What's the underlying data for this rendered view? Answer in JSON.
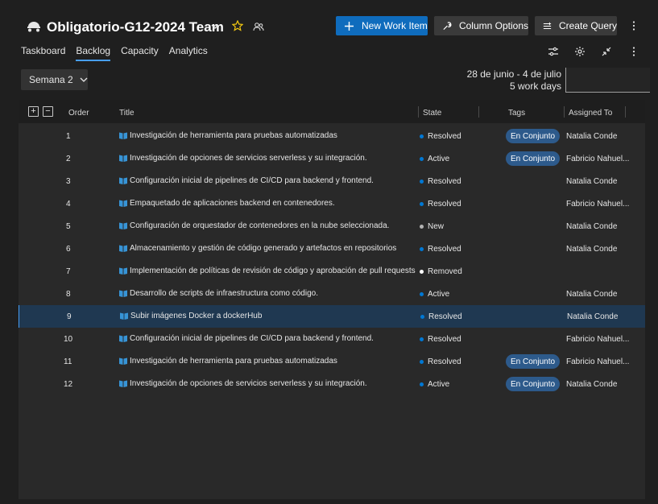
{
  "header": {
    "team_title": "Obligatorio-G12-2024 Team",
    "new_work_item": "New Work Item",
    "column_options": "Column Options",
    "create_query": "Create Query"
  },
  "tabs": [
    "Taskboard",
    "Backlog",
    "Capacity",
    "Analytics"
  ],
  "active_tab": "Backlog",
  "sprint": {
    "selector": "Semana 2",
    "date_range": "28 de junio - 4 de julio",
    "work_days": "5 work days"
  },
  "columns": {
    "order": "Order",
    "title": "Title",
    "state": "State",
    "tags": "Tags",
    "assigned": "Assigned To"
  },
  "expand_all": "+",
  "collapse_all": "−",
  "state_colors": {
    "Resolved": "#0078d4",
    "Active": "#0078d4",
    "New": "#b2b2b2",
    "Removed": "#ffffff"
  },
  "rows": [
    {
      "order": "1",
      "title": "Investigación de herramienta para pruebas automatizadas",
      "state": "Resolved",
      "tag": "En Conjunto",
      "assigned": "Natalia Conde"
    },
    {
      "order": "2",
      "title": "Investigación de opciones de servicios serverless y su integración.",
      "state": "Active",
      "tag": "En Conjunto",
      "assigned": "Fabricio Nahuel..."
    },
    {
      "order": "3",
      "title": "Configuración inicial de pipelines de CI/CD para backend y frontend.",
      "state": "Resolved",
      "tag": "",
      "assigned": "Natalia Conde"
    },
    {
      "order": "4",
      "title": "Empaquetado de aplicaciones backend en contenedores.",
      "state": "Resolved",
      "tag": "",
      "assigned": "Fabricio Nahuel..."
    },
    {
      "order": "5",
      "title": "Configuración de orquestador de contenedores en la nube seleccionada.",
      "state": "New",
      "tag": "",
      "assigned": "Natalia Conde"
    },
    {
      "order": "6",
      "title": "Almacenamiento y gestión de código generado y artefactos en repositorios",
      "state": "Resolved",
      "tag": "",
      "assigned": "Natalia Conde"
    },
    {
      "order": "7",
      "title": "Implementación de políticas de revisión de código y aprobación de pull requests",
      "state": "Removed",
      "tag": "",
      "assigned": ""
    },
    {
      "order": "8",
      "title": "Desarrollo de scripts de infraestructura como código.",
      "state": "Active",
      "tag": "",
      "assigned": "Natalia Conde"
    },
    {
      "order": "9",
      "title": "Subir imágenes Docker a dockerHub",
      "state": "Resolved",
      "tag": "",
      "assigned": "Natalia Conde",
      "selected": true
    },
    {
      "order": "10",
      "title": "Configuración inicial de pipelines de CI/CD para backend y frontend.",
      "state": "Resolved",
      "tag": "",
      "assigned": "Fabricio Nahuel..."
    },
    {
      "order": "11",
      "title": "Investigación de herramienta para pruebas automatizadas",
      "state": "Resolved",
      "tag": "En Conjunto",
      "assigned": "Fabricio Nahuel..."
    },
    {
      "order": "12",
      "title": "Investigación de opciones de servicios serverless y su integración.",
      "state": "Active",
      "tag": "En Conjunto",
      "assigned": "Natalia Conde"
    }
  ],
  "icons": {
    "team": "team-icon",
    "favorite": "star-icon",
    "members": "people-icon",
    "new": "plus-icon",
    "column_options": "wrench-icon",
    "query": "query-icon",
    "more": "more-icon",
    "filter": "filter-icon",
    "settings": "gear-icon",
    "fullscreen": "collapse-icon",
    "work_item": "book-icon"
  }
}
